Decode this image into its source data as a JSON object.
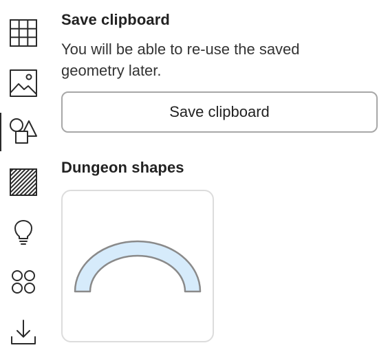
{
  "sidebar": {
    "items": [
      {
        "icon": "grid-icon",
        "active": false
      },
      {
        "icon": "image-icon",
        "active": false
      },
      {
        "icon": "shapes-icon",
        "active": true
      },
      {
        "icon": "hatch-pattern-icon",
        "active": false
      },
      {
        "icon": "lightbulb-icon",
        "active": false
      },
      {
        "icon": "apps-icon",
        "active": false
      },
      {
        "icon": "download-icon",
        "active": false
      }
    ]
  },
  "clipboard": {
    "title": "Save clipboard",
    "description": "You will be able to re-use the saved geometry later.",
    "button_label": "Save clipboard"
  },
  "dungeon": {
    "title": "Dungeon shapes",
    "shapes": [
      {
        "name": "arch",
        "fill": "#d6ebfb",
        "stroke": "#8a8a8a"
      }
    ]
  },
  "colors": {
    "text": "#222222",
    "border": "#a7a7a7",
    "card_border": "#dcdcdc",
    "shape_fill": "#d6ebfb",
    "shape_stroke": "#8a8a8a"
  }
}
